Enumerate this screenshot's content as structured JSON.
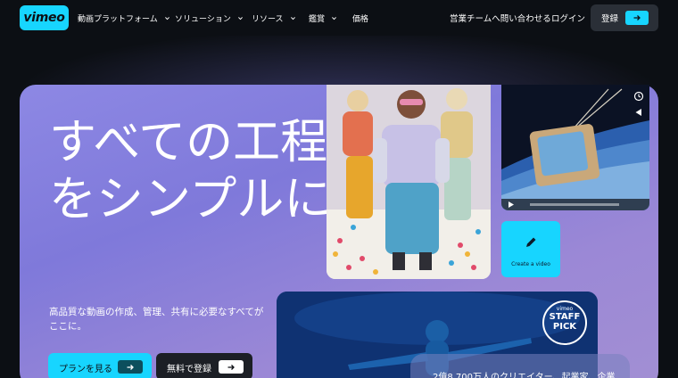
{
  "brand": {
    "logo_text": "vimeo",
    "accent": "#17d5ff",
    "background": "#0c0f14"
  },
  "nav": {
    "items": [
      {
        "label": "動画プラットフォーム",
        "has_dropdown": true
      },
      {
        "label": "ソリューション",
        "has_dropdown": true
      },
      {
        "label": "リソース",
        "has_dropdown": true
      },
      {
        "label": "鑑賞",
        "has_dropdown": true
      },
      {
        "label": "価格",
        "has_dropdown": false
      }
    ],
    "contact_sales": "営業チームへ問い合わせる",
    "login": "ログイン",
    "signup": "登録"
  },
  "hero": {
    "headline": "すべての工程をシンプルに",
    "subtext": "高品質な動画の作成、管理、共有に必要なすべてがここに。",
    "primary_button": "プランを見る",
    "secondary_button": "無料で登録"
  },
  "cards": {
    "create_video_label": "Create a video",
    "staff_pick_top": "vimeo",
    "staff_pick_line1": "STAFF",
    "staff_pick_line2": "PICK",
    "overlay_text": "2億8,700万人のクリエイター、起業家、企業"
  }
}
